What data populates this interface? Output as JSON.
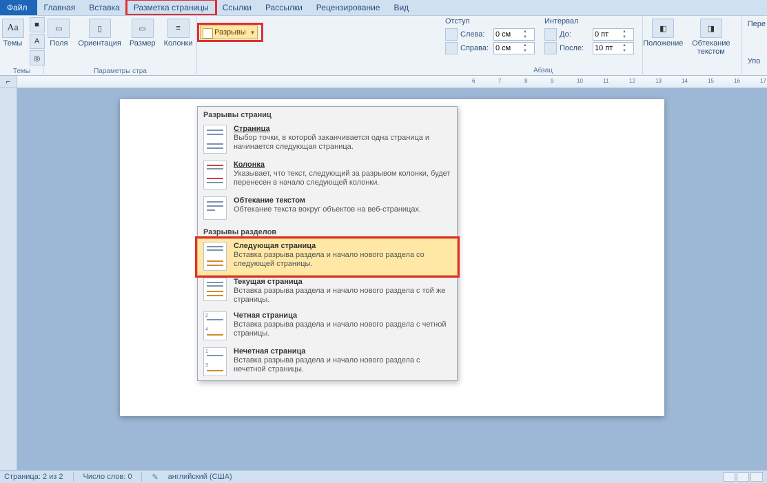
{
  "tabs": {
    "file": "Файл",
    "home": "Главная",
    "insert": "Вставка",
    "pagelayout": "Разметка страницы",
    "links": "Ссылки",
    "mailings": "Рассылки",
    "review": "Рецензирование",
    "view": "Вид"
  },
  "ribbon": {
    "themes_group": "Темы",
    "themes": "Темы",
    "margins": "Поля",
    "orientation": "Ориентация",
    "size": "Размер",
    "columns": "Колонки",
    "page_setup_group": "Параметры стра",
    "breaks": "Разрывы",
    "indent_header": "Отступ",
    "left": "Слева:",
    "right": "Справа:",
    "left_val": "0 см",
    "right_val": "0 см",
    "spacing_header": "Интервал",
    "before": "До:",
    "after": "После:",
    "before_val": "0 пт",
    "after_val": "10 пт",
    "paragraph_group": "Абзац",
    "position": "Положение",
    "wrap": "Обтекание текстом",
    "arrange_truncated1": "Пере",
    "arrange_truncated2": "Упо"
  },
  "dropdown": {
    "header_pages": "Разрывы страниц",
    "page_t": "Страница",
    "page_d": "Выбор точки, в которой заканчивается одна страница и начинается следующая страница.",
    "column_t": "Колонка",
    "column_d": "Указывает, что текст, следующий за разрывом колонки, будет перенесен в начало следующей колонки.",
    "wrap_t": "Обтекание текстом",
    "wrap_d": "Обтекание текста вокруг объектов на веб-страницах.",
    "header_sections": "Разрывы разделов",
    "next_t": "Следующая страница",
    "next_d": "Вставка разрыва раздела и начало нового раздела со следующей страницы.",
    "cont_t": "Текущая страница",
    "cont_d": "Вставка разрыва раздела и начало нового раздела с той же страницы.",
    "even_t": "Четная страница",
    "even_d": "Вставка разрыва раздела и начало нового раздела с четной страницы.",
    "odd_t": "Нечетная страница",
    "odd_d": "Вставка разрыва раздела и начало нового раздела с нечетной страницы."
  },
  "ruler_nums": [
    6,
    7,
    8,
    9,
    10,
    11,
    12,
    13,
    14,
    15,
    16,
    17
  ],
  "status": {
    "page": "Страница: 2 из 2",
    "words": "Число слов: 0",
    "lang": "английский (США)"
  }
}
